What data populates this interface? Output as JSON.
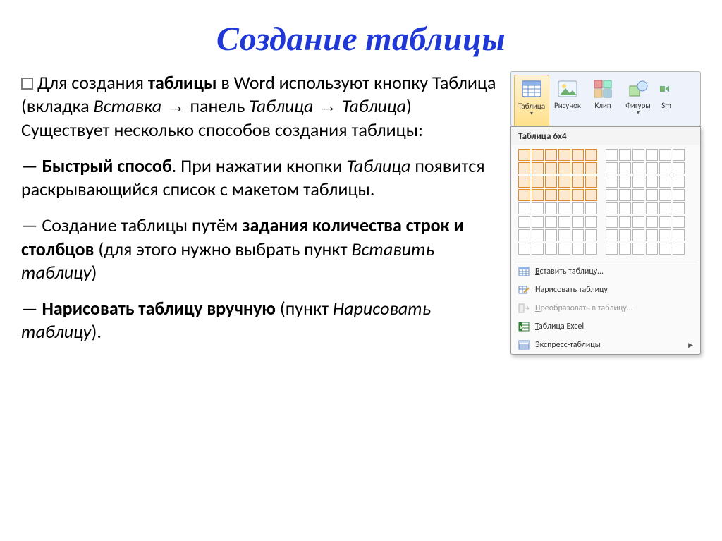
{
  "title": "Создание таблицы",
  "para1_a": "Для создания ",
  "para1_b": "таблицы",
  "para1_c": " в Word используют кнопку Таблица (вкладка ",
  "para1_d": "Вставка",
  "para1_e": " панель ",
  "para1_f": "Таблица",
  "para1_g": "Таблица",
  "para1_h": ") Существует несколько способов создания таблицы:",
  "dash": "—",
  "p2_a": "Быстрый способ",
  "p2_b": ". При нажатии кнопки ",
  "p2_c": "Таблица",
  "p2_d": "  появится раскрывающийся список с макетом таблицы.",
  "p3_a": " Создание таблицы путём ",
  "p3_b": "задания количества строк и столбцов",
  "p3_c": " (для этого нужно выбрать пункт ",
  "p3_d": "Вставить таблицу",
  "p3_e": ")",
  "p4_a": "Нарисовать таблицу вручную",
  "p4_b": " (пункт ",
  "p4_c": "Нарисовать таблицу",
  "p4_d": ").",
  "ribbon": {
    "table": "Таблица",
    "picture": "Рисунок",
    "clip": "Клип",
    "shapes": "Фигуры",
    "smart": "Sm"
  },
  "dropdown": {
    "header": "Таблица 6x4",
    "insert": "Вставить таблицу...",
    "draw": "Нарисовать таблицу",
    "convert": "Преобразовать в таблицу...",
    "excel": "Таблица Excel",
    "express": "Экспресс-таблицы"
  }
}
